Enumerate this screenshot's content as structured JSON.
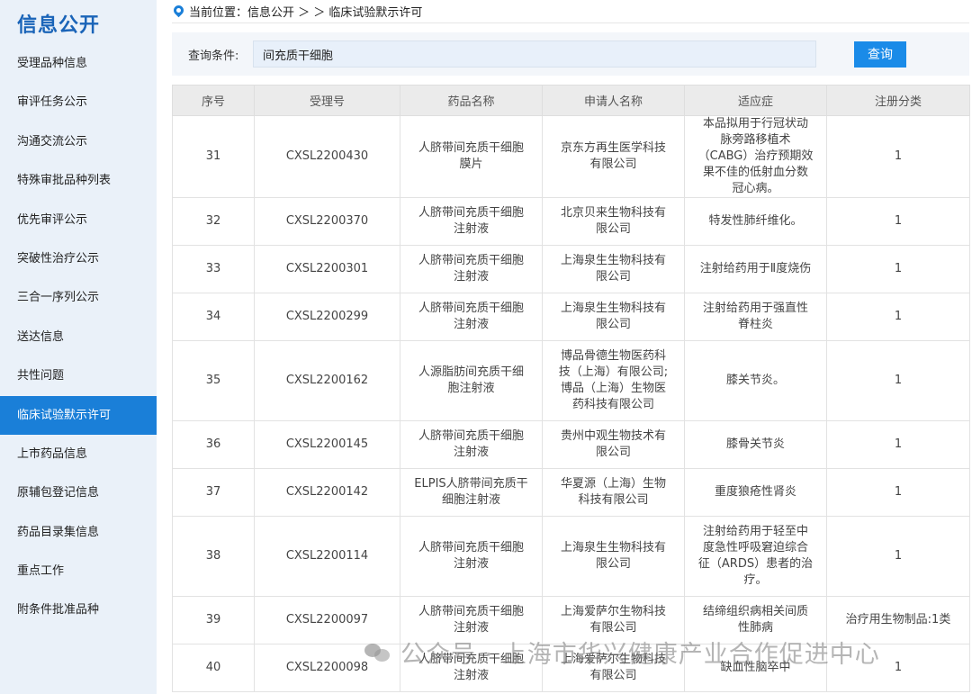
{
  "sidebar": {
    "title": "信息公开",
    "items": [
      {
        "label": "受理品种信息",
        "active": false
      },
      {
        "label": "审评任务公示",
        "active": false
      },
      {
        "label": "沟通交流公示",
        "active": false
      },
      {
        "label": "特殊审批品种列表",
        "active": false
      },
      {
        "label": "优先审评公示",
        "active": false
      },
      {
        "label": "突破性治疗公示",
        "active": false
      },
      {
        "label": "三合一序列公示",
        "active": false
      },
      {
        "label": "送达信息",
        "active": false
      },
      {
        "label": "共性问题",
        "active": false
      },
      {
        "label": "临床试验默示许可",
        "active": true
      },
      {
        "label": "上市药品信息",
        "active": false
      },
      {
        "label": "原辅包登记信息",
        "active": false
      },
      {
        "label": "药品目录集信息",
        "active": false
      },
      {
        "label": "重点工作",
        "active": false
      },
      {
        "label": "附条件批准品种",
        "active": false
      }
    ]
  },
  "breadcrumb": {
    "text": "当前位置：信息公开 ＞ ＞ 临床试验默示许可"
  },
  "query": {
    "label": "查询条件:",
    "value": "间充质干细胞",
    "button": "查询"
  },
  "table": {
    "headers": [
      "序号",
      "受理号",
      "药品名称",
      "申请人名称",
      "适应症",
      "注册分类"
    ],
    "rows": [
      {
        "no": "31",
        "id": "CXSL2200430",
        "drug": "人脐带间充质干细胞膜片",
        "applicant": "京东方再生医学科技有限公司",
        "indication": "本品拟用于行冠状动脉旁路移植术（CABG）治疗预期效果不佳的低射血分数冠心病。",
        "category": "1"
      },
      {
        "no": "32",
        "id": "CXSL2200370",
        "drug": "人脐带间充质干细胞注射液",
        "applicant": "北京贝来生物科技有限公司",
        "indication": "特发性肺纤维化。",
        "category": "1"
      },
      {
        "no": "33",
        "id": "CXSL2200301",
        "drug": "人脐带间充质干细胞注射液",
        "applicant": "上海泉生生物科技有限公司",
        "indication": "注射给药用于Ⅱ度烧伤",
        "category": "1"
      },
      {
        "no": "34",
        "id": "CXSL2200299",
        "drug": "人脐带间充质干细胞注射液",
        "applicant": "上海泉生生物科技有限公司",
        "indication": "注射给药用于强直性脊柱炎",
        "category": "1"
      },
      {
        "no": "35",
        "id": "CXSL2200162",
        "drug": "人源脂肪间充质干细胞注射液",
        "applicant": "博品骨德生物医药科技（上海）有限公司;博品（上海）生物医药科技有限公司",
        "indication": "膝关节炎。",
        "category": "1"
      },
      {
        "no": "36",
        "id": "CXSL2200145",
        "drug": "人脐带间充质干细胞注射液",
        "applicant": "贵州中观生物技术有限公司",
        "indication": "膝骨关节炎",
        "category": "1"
      },
      {
        "no": "37",
        "id": "CXSL2200142",
        "drug": "ELPIS人脐带间充质干细胞注射液",
        "applicant": "华夏源（上海）生物科技有限公司",
        "indication": "重度狼疮性肾炎",
        "category": "1"
      },
      {
        "no": "38",
        "id": "CXSL2200114",
        "drug": "人脐带间充质干细胞注射液",
        "applicant": "上海泉生生物科技有限公司",
        "indication": "注射给药用于轻至中度急性呼吸窘迫综合征（ARDS）患者的治疗。",
        "category": "1"
      },
      {
        "no": "39",
        "id": "CXSL2200097",
        "drug": "人脐带间充质干细胞注射液",
        "applicant": "上海爱萨尔生物科技有限公司",
        "indication": "结缔组织病相关间质性肺病",
        "category": "治疗用生物制品:1类"
      },
      {
        "no": "40",
        "id": "CXSL2200098",
        "drug": "人脐带间充质干细胞注射液",
        "applicant": "上海爱萨尔生物科技有限公司",
        "indication": "缺血性脑卒中",
        "category": "1"
      }
    ]
  },
  "watermark": {
    "icon": "wechat-icon",
    "text": "公众号 · 上海市华兴健康产业合作促进中心"
  },
  "colors": {
    "accent": "#1a7fd8",
    "sidebar_bg": "#eaf1f9",
    "title": "#1a64b8"
  }
}
